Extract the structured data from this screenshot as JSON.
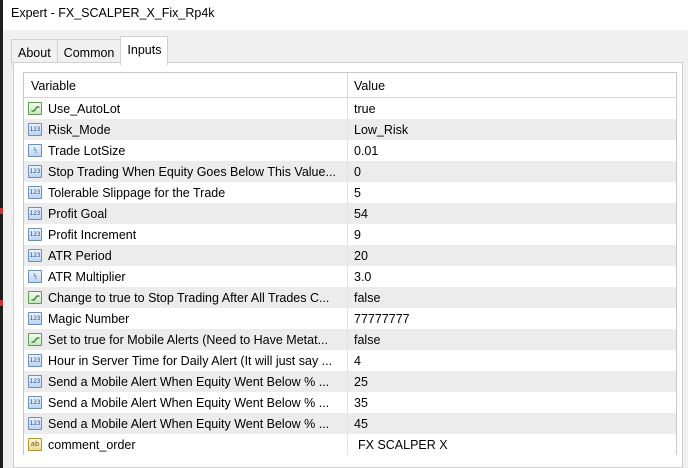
{
  "window": {
    "title": "Expert - FX_SCALPER_X_Fix_Rp4k"
  },
  "tabs": [
    {
      "label": "About",
      "active": false
    },
    {
      "label": "Common",
      "active": false
    },
    {
      "label": "Inputs",
      "active": true
    }
  ],
  "table": {
    "columns": {
      "variable": "Variable",
      "value": "Value"
    },
    "rows": [
      {
        "type": "bool",
        "icon": "bool-icon",
        "name": "Use_AutoLot",
        "value": "true"
      },
      {
        "type": "int",
        "icon": "int-icon",
        "name": "Risk_Mode",
        "value": "Low_Risk"
      },
      {
        "type": "double",
        "icon": "double-icon",
        "name": "Trade LotSize",
        "value": "0.01"
      },
      {
        "type": "int",
        "icon": "int-icon",
        "name": "Stop Trading When Equity Goes Below This Value...",
        "value": "0"
      },
      {
        "type": "int",
        "icon": "int-icon",
        "name": "Tolerable Slippage for the Trade",
        "value": "5"
      },
      {
        "type": "int",
        "icon": "int-icon",
        "name": "Profit Goal",
        "value": "54"
      },
      {
        "type": "int",
        "icon": "int-icon",
        "name": "Profit Increment",
        "value": "9"
      },
      {
        "type": "int",
        "icon": "int-icon",
        "name": "ATR Period",
        "value": "20"
      },
      {
        "type": "double",
        "icon": "double-icon",
        "name": "ATR Multiplier",
        "value": "3.0"
      },
      {
        "type": "bool",
        "icon": "bool-icon",
        "name": "Change to true to Stop Trading After All Trades C...",
        "value": "false"
      },
      {
        "type": "int",
        "icon": "int-icon",
        "name": "Magic Number",
        "value": "77777777"
      },
      {
        "type": "bool",
        "icon": "bool-icon",
        "name": "Set to true for Mobile Alerts (Need to Have Metat...",
        "value": "false"
      },
      {
        "type": "int",
        "icon": "int-icon",
        "name": "Hour in Server Time for Daily Alert (It will just say ...",
        "value": "4"
      },
      {
        "type": "int",
        "icon": "int-icon",
        "name": "Send a Mobile Alert When Equity Went Below % ...",
        "value": "25"
      },
      {
        "type": "int",
        "icon": "int-icon",
        "name": "Send a Mobile Alert When Equity Went Below % ...",
        "value": "35"
      },
      {
        "type": "int",
        "icon": "int-icon",
        "name": "Send a Mobile Alert When Equity Went Below % ...",
        "value": "45"
      },
      {
        "type": "string",
        "icon": "string-icon",
        "name": "comment_order",
        "value": "FX SCALPER X"
      }
    ]
  },
  "icon_glyphs": {
    "int": "123",
    "double": "½",
    "string": "ab"
  },
  "colors": {
    "int_icon_border": "#6b8fb8",
    "bool_icon_border": "#5d9a52",
    "string_icon_border": "#b39430",
    "alt_row": "#ececec"
  }
}
